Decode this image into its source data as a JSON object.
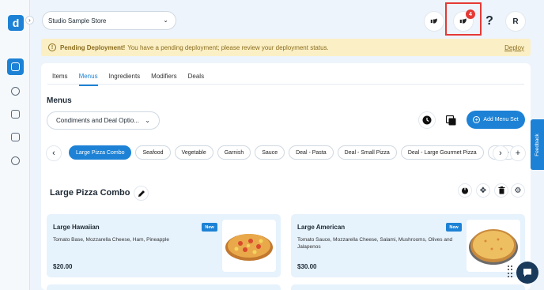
{
  "logo": {
    "letter": "d"
  },
  "collapse_icon": "›",
  "store": {
    "selected": "Studio Sample Store"
  },
  "top": {
    "notification_count": "4",
    "help": "?",
    "avatar_initial": "R"
  },
  "alert": {
    "title": "Pending Deployment!",
    "message": "You have a pending deployment; please review your deployment status.",
    "action": "Deploy"
  },
  "tabs": [
    {
      "label": "Items"
    },
    {
      "label": "Menus"
    },
    {
      "label": "Ingredients"
    },
    {
      "label": "Modifiers"
    },
    {
      "label": "Deals"
    }
  ],
  "section_title": "Menus",
  "menu_select": {
    "selected": "Condiments and Deal Optio..."
  },
  "add_menu_label": "Add Menu Set",
  "chips": [
    {
      "label": "Large Pizza Combo"
    },
    {
      "label": "Seafood"
    },
    {
      "label": "Vegetable"
    },
    {
      "label": "Garnish"
    },
    {
      "label": "Sauce"
    },
    {
      "label": "Deal - Pasta"
    },
    {
      "label": "Deal - Small Pizza"
    },
    {
      "label": "Deal - Large Gourmet Pizza"
    },
    {
      "label": "Deal -"
    }
  ],
  "group_title": "Large Pizza Combo",
  "items": [
    {
      "name": "Large Hawaiian",
      "badge": "New",
      "description": "Tomato Base, Mozzarella Cheese, Ham, Pineapple",
      "price": "$20.00"
    },
    {
      "name": "Large American",
      "badge": "New",
      "description": "Tomato Sauce, Mozzarella Cheese, Salami, Mushrooms, Olives and Jalapenos",
      "price": "$30.00"
    }
  ],
  "feedback_label": "Feedback",
  "colors": {
    "accent": "#1d82d5",
    "alert_bg": "#fbefc5",
    "badge": "#e53935",
    "card_bg": "#e6f2fc"
  },
  "icons": [
    "rocket-icon",
    "bell-rocket-icon",
    "clock-icon",
    "copy-icon",
    "chevron-left-icon",
    "chevron-right-icon",
    "plus-icon",
    "pencil-icon",
    "power-icon",
    "move-icon",
    "trash-icon",
    "gear-icon",
    "chat-icon"
  ]
}
